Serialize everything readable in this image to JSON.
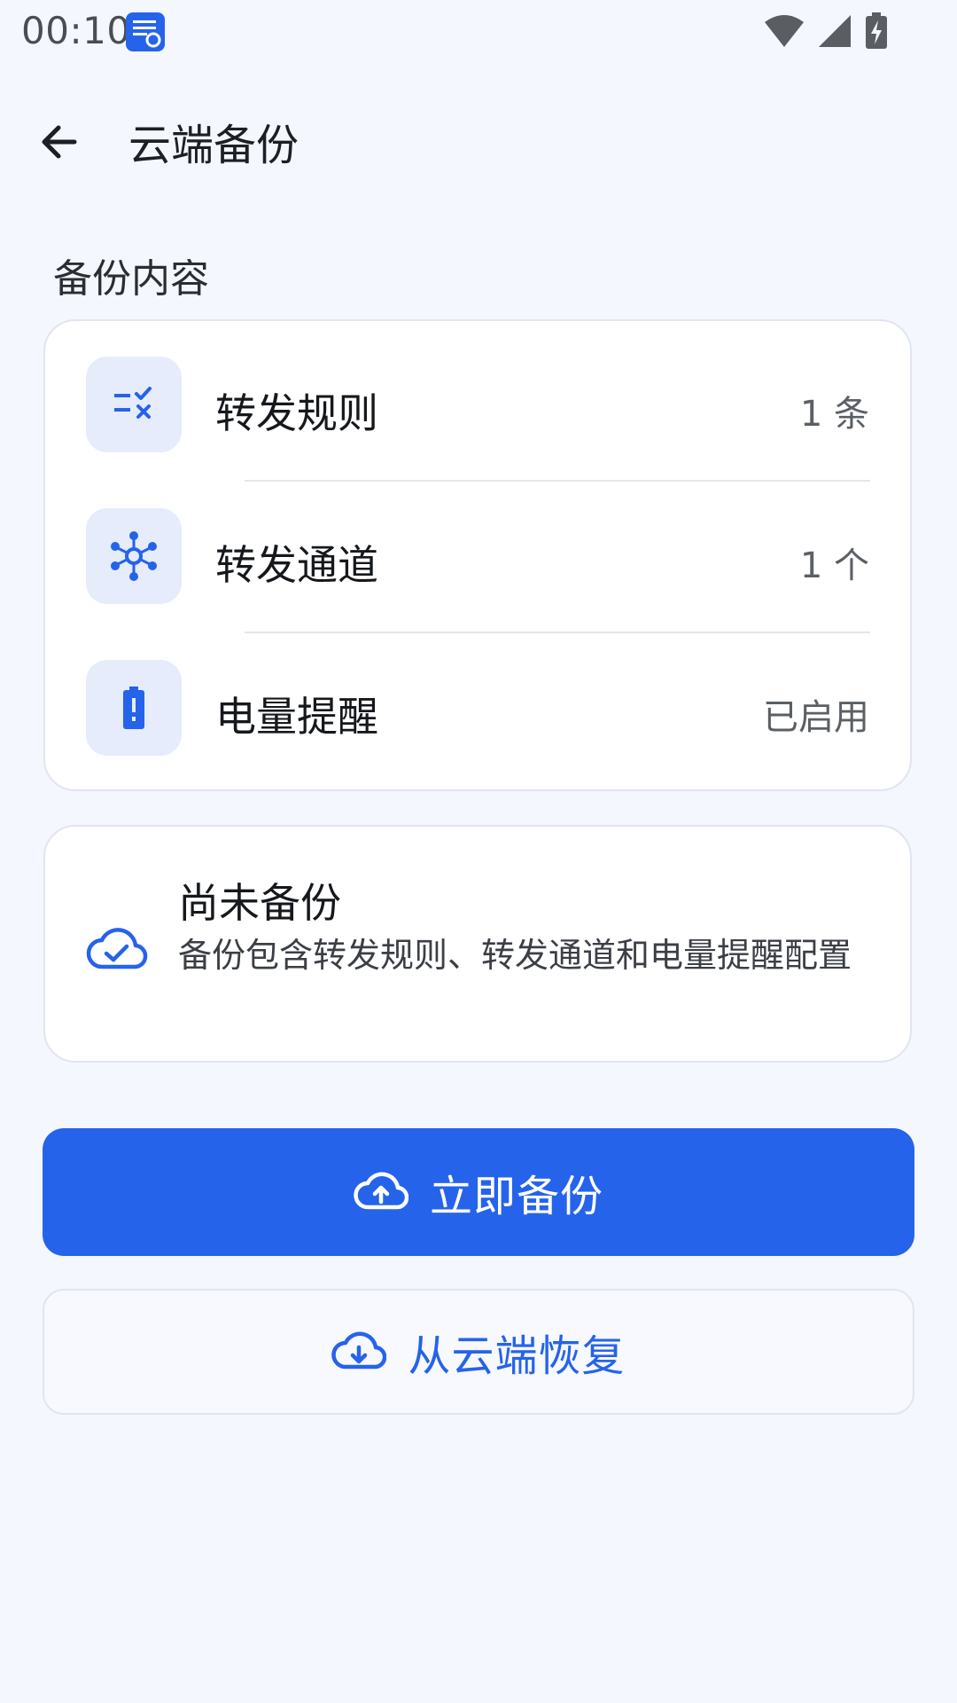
{
  "status_bar": {
    "time": "00:10",
    "icons": [
      "message-sync-icon",
      "wifi-icon",
      "cellular-signal-icon",
      "battery-charging-icon"
    ]
  },
  "app_bar": {
    "back_icon": "arrow-left-icon",
    "title": "云端备份"
  },
  "section": {
    "label": "备份内容"
  },
  "backup_items": [
    {
      "icon": "rule-check-icon",
      "label": "转发规则",
      "value": "1 条"
    },
    {
      "icon": "hub-nodes-icon",
      "label": "转发通道",
      "value": "1 个"
    },
    {
      "icon": "battery-alert-icon",
      "label": "电量提醒",
      "value": "已启用"
    }
  ],
  "status": {
    "icon": "cloud-check-icon",
    "title": "尚未备份",
    "description": "备份包含转发规则、转发通道和电量提醒配置"
  },
  "actions": {
    "backup_now": {
      "icon": "cloud-upload-icon",
      "label": "立即备份"
    },
    "restore": {
      "icon": "cloud-download-icon",
      "label": "从云端恢复"
    }
  },
  "colors": {
    "accent": "#2563eb",
    "background": "#f4f7fd",
    "tile": "#e6ecfc"
  }
}
